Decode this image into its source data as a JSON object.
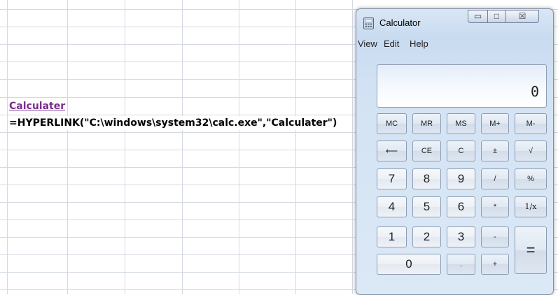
{
  "spreadsheet": {
    "link_cell": "Calculater",
    "formula_cell": "=HYPERLINK(\"C:\\windows\\system32\\calc.exe\",\"Calculater\")"
  },
  "calculator": {
    "title": "Calculator",
    "window_buttons": {
      "minimize": "▭",
      "maximize": "□",
      "close": "☒"
    },
    "menu": [
      "View",
      "Edit",
      "Help"
    ],
    "display": "0",
    "keys": {
      "mc": "MC",
      "mr": "MR",
      "ms": "MS",
      "mplus": "M+",
      "mminus": "M-",
      "backspace": "⟵",
      "ce": "CE",
      "c": "C",
      "plusminus": "±",
      "sqrt": "√",
      "n7": "7",
      "n8": "8",
      "n9": "9",
      "divide": "/",
      "percent": "%",
      "n4": "4",
      "n5": "5",
      "n6": "6",
      "multiply": "*",
      "reciprocal": "1/x",
      "n1": "1",
      "n2": "2",
      "n3": "3",
      "subtract": "-",
      "equals": "=",
      "n0": "0",
      "decimal": ".",
      "add": "+"
    },
    "icons": {
      "app": "calculator-icon"
    },
    "colors": {
      "link": "#7a2d8f",
      "frame": "#c9dbf0"
    }
  }
}
